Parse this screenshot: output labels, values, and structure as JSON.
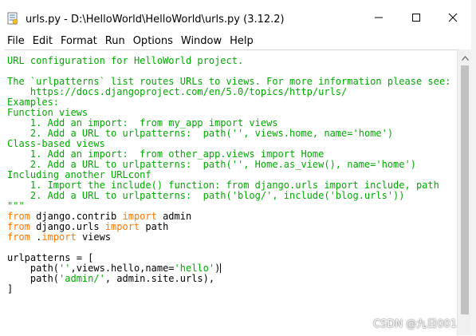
{
  "window": {
    "title": "urls.py - D:\\HelloWorld\\HelloWorld\\urls.py (3.12.2)"
  },
  "menu": [
    "File",
    "Edit",
    "Format",
    "Run",
    "Options",
    "Window",
    "Help"
  ],
  "editor": {
    "lines": [
      [
        {
          "cls": "c",
          "text": "\"\"\""
        }
      ],
      [
        {
          "cls": "c",
          "text": "URL configuration for HelloWorld project."
        }
      ],
      [
        {
          "cls": "c",
          "text": ""
        }
      ],
      [
        {
          "cls": "c",
          "text": "The `urlpatterns` list routes URLs to views. For more information please see:"
        }
      ],
      [
        {
          "cls": "c",
          "text": "    https://docs.djangoproject.com/en/5.0/topics/http/urls/"
        }
      ],
      [
        {
          "cls": "c",
          "text": "Examples:"
        }
      ],
      [
        {
          "cls": "c",
          "text": "Function views"
        }
      ],
      [
        {
          "cls": "c",
          "text": "    1. Add an import:  from my_app import views"
        }
      ],
      [
        {
          "cls": "c",
          "text": "    2. Add a URL to urlpatterns:  path('', views.home, name='home')"
        }
      ],
      [
        {
          "cls": "c",
          "text": "Class-based views"
        }
      ],
      [
        {
          "cls": "c",
          "text": "    1. Add an import:  from other_app.views import Home"
        }
      ],
      [
        {
          "cls": "c",
          "text": "    2. Add a URL to urlpatterns:  path('', Home.as_view(), name='home')"
        }
      ],
      [
        {
          "cls": "c",
          "text": "Including another URLconf"
        }
      ],
      [
        {
          "cls": "c",
          "text": "    1. Import the include() function: from django.urls import include, path"
        }
      ],
      [
        {
          "cls": "c",
          "text": "    2. Add a URL to urlpatterns:  path('blog/', include('blog.urls'))"
        }
      ],
      [
        {
          "cls": "c",
          "text": "\"\"\""
        }
      ],
      [
        {
          "cls": "k",
          "text": "from"
        },
        {
          "cls": "t",
          "text": " django.contrib "
        },
        {
          "cls": "k",
          "text": "import"
        },
        {
          "cls": "t",
          "text": " admin"
        }
      ],
      [
        {
          "cls": "k",
          "text": "from"
        },
        {
          "cls": "t",
          "text": " django.urls "
        },
        {
          "cls": "k",
          "text": "import"
        },
        {
          "cls": "t",
          "text": " path"
        }
      ],
      [
        {
          "cls": "k",
          "text": "from"
        },
        {
          "cls": "t",
          "text": " ."
        },
        {
          "cls": "k",
          "text": "import"
        },
        {
          "cls": "t",
          "text": " views"
        }
      ],
      [
        {
          "cls": "t",
          "text": ""
        }
      ],
      [
        {
          "cls": "t",
          "text": "urlpatterns = ["
        }
      ],
      [
        {
          "cls": "t",
          "text": "    path("
        },
        {
          "cls": "s",
          "text": "''"
        },
        {
          "cls": "t",
          "text": ",views.hello,name="
        },
        {
          "cls": "s",
          "text": "'hello'"
        },
        {
          "cls": "t",
          "text": ")"
        },
        {
          "cls": "cursor",
          "text": ""
        }
      ],
      [
        {
          "cls": "t",
          "text": "    path("
        },
        {
          "cls": "s",
          "text": "'admin/'"
        },
        {
          "cls": "t",
          "text": ", admin.site.urls),"
        }
      ],
      [
        {
          "cls": "t",
          "text": "]"
        }
      ]
    ]
  },
  "watermark": "CSDN @九日001"
}
